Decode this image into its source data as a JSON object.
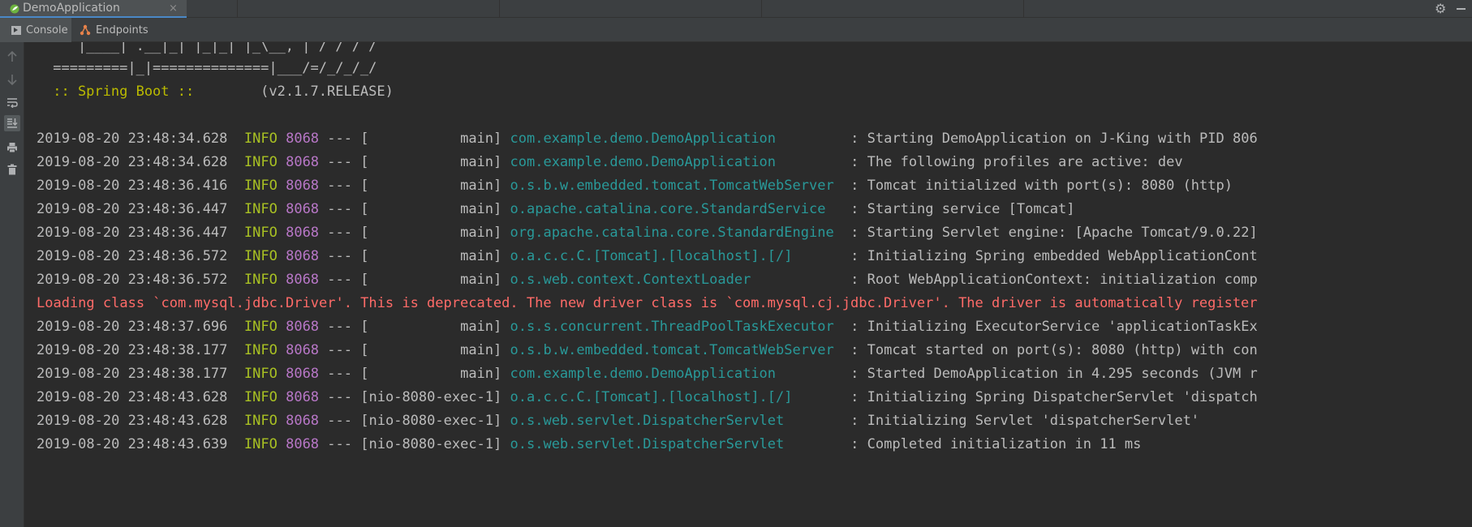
{
  "run_tab": {
    "title": "DemoApplication",
    "close_glyph": "×"
  },
  "toolbar_icons": [
    "gear-icon",
    "hide-panel-icon"
  ],
  "tool_tabs": [
    {
      "label": "Console",
      "icon": "console-icon",
      "active": true
    },
    {
      "label": "Endpoints",
      "icon": "endpoints-icon",
      "active": false
    }
  ],
  "left_tools": [
    "up-arrow-icon",
    "down-arrow-icon",
    "soft-wrap-icon",
    "scroll-to-end-icon",
    "print-icon",
    "trash-icon"
  ],
  "banner": {
    "line1": "    |____| .__|_| |_|_| |_\\__, | / / / /",
    "line2": " =========|_|==============|___/=/_/_/_/",
    "spring_label": " :: Spring Boot :: ",
    "version": "       (v2.1.7.RELEASE)"
  },
  "logs": [
    {
      "ts": "2019-08-20 23:48:34.628",
      "level": "INFO",
      "pid": "8068",
      "sep": "---",
      "thread": "[           main]",
      "logger": "com.example.demo.DemoApplication        ",
      "msg": ": Starting DemoApplication on J-King with PID 806"
    },
    {
      "ts": "2019-08-20 23:48:34.628",
      "level": "INFO",
      "pid": "8068",
      "sep": "---",
      "thread": "[           main]",
      "logger": "com.example.demo.DemoApplication        ",
      "msg": ": The following profiles are active: dev"
    },
    {
      "ts": "2019-08-20 23:48:36.416",
      "level": "INFO",
      "pid": "8068",
      "sep": "---",
      "thread": "[           main]",
      "logger": "o.s.b.w.embedded.tomcat.TomcatWebServer ",
      "msg": ": Tomcat initialized with port(s): 8080 (http)"
    },
    {
      "ts": "2019-08-20 23:48:36.447",
      "level": "INFO",
      "pid": "8068",
      "sep": "---",
      "thread": "[           main]",
      "logger": "o.apache.catalina.core.StandardService  ",
      "msg": ": Starting service [Tomcat]"
    },
    {
      "ts": "2019-08-20 23:48:36.447",
      "level": "INFO",
      "pid": "8068",
      "sep": "---",
      "thread": "[           main]",
      "logger": "org.apache.catalina.core.StandardEngine ",
      "msg": ": Starting Servlet engine: [Apache Tomcat/9.0.22]"
    },
    {
      "ts": "2019-08-20 23:48:36.572",
      "level": "INFO",
      "pid": "8068",
      "sep": "---",
      "thread": "[           main]",
      "logger": "o.a.c.c.C.[Tomcat].[localhost].[/]      ",
      "msg": ": Initializing Spring embedded WebApplicationCont"
    },
    {
      "ts": "2019-08-20 23:48:36.572",
      "level": "INFO",
      "pid": "8068",
      "sep": "---",
      "thread": "[           main]",
      "logger": "o.s.web.context.ContextLoader           ",
      "msg": ": Root WebApplicationContext: initialization comp"
    },
    {
      "error": "Loading class `com.mysql.jdbc.Driver'. This is deprecated. The new driver class is `com.mysql.cj.jdbc.Driver'. The driver is automatically register"
    },
    {
      "ts": "2019-08-20 23:48:37.696",
      "level": "INFO",
      "pid": "8068",
      "sep": "---",
      "thread": "[           main]",
      "logger": "o.s.s.concurrent.ThreadPoolTaskExecutor ",
      "msg": ": Initializing ExecutorService 'applicationTaskEx"
    },
    {
      "ts": "2019-08-20 23:48:38.177",
      "level": "INFO",
      "pid": "8068",
      "sep": "---",
      "thread": "[           main]",
      "logger": "o.s.b.w.embedded.tomcat.TomcatWebServer ",
      "msg": ": Tomcat started on port(s): 8080 (http) with con"
    },
    {
      "ts": "2019-08-20 23:48:38.177",
      "level": "INFO",
      "pid": "8068",
      "sep": "---",
      "thread": "[           main]",
      "logger": "com.example.demo.DemoApplication        ",
      "msg": ": Started DemoApplication in 4.295 seconds (JVM r"
    },
    {
      "ts": "2019-08-20 23:48:43.628",
      "level": "INFO",
      "pid": "8068",
      "sep": "---",
      "thread": "[nio-8080-exec-1]",
      "logger": "o.a.c.c.C.[Tomcat].[localhost].[/]      ",
      "msg": ": Initializing Spring DispatcherServlet 'dispatch"
    },
    {
      "ts": "2019-08-20 23:48:43.628",
      "level": "INFO",
      "pid": "8068",
      "sep": "---",
      "thread": "[nio-8080-exec-1]",
      "logger": "o.s.web.servlet.DispatcherServlet       ",
      "msg": ": Initializing Servlet 'dispatcherServlet'"
    },
    {
      "ts": "2019-08-20 23:48:43.639",
      "level": "INFO",
      "pid": "8068",
      "sep": "---",
      "thread": "[nio-8080-exec-1]",
      "logger": "o.s.web.servlet.DispatcherServlet       ",
      "msg": ": Completed initialization in 11 ms"
    }
  ]
}
